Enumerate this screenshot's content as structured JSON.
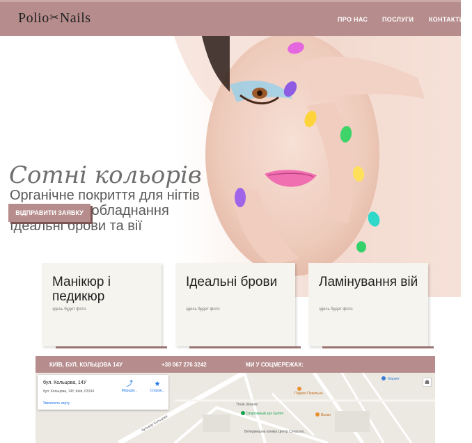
{
  "header": {
    "logo_left": "Polio",
    "logo_right": "Nails",
    "nav": [
      {
        "label": "ПРО НАС"
      },
      {
        "label": "ПОСЛУГИ"
      },
      {
        "label": "КОНТАКТИ"
      }
    ]
  },
  "hero": {
    "title": "Сотні кольорів",
    "lines": [
      "Органічне покриття для нігтів",
      "Професійне обладнання",
      "Ідеальні брови та вії"
    ],
    "cta": "ВІДПРАВИТИ ЗАЯВКУ"
  },
  "cards": [
    {
      "title": "Манікюр і педикюр",
      "note": "здесь будет фото"
    },
    {
      "title": "Ідеальні брови",
      "note": "здесь будет фото"
    },
    {
      "title": "Ламінування вій",
      "note": "здесь будет фото"
    }
  ],
  "footer": {
    "address": "КИЇВ, БУЛ. КОЛЬЦОВА 14У",
    "phone": "+38 067 276 3242",
    "social": "МИ У СОЦМЕРЕЖАХ:"
  },
  "map": {
    "place_title": "бул. Кольцова, 14У",
    "place_address": "бул. Кольцова, 14У, Київ, 03194",
    "enlarge_link": "Увеличить карту",
    "route_label": "Маршру...",
    "save_label": "Сохран...",
    "labels": [
      "Thule Ukraine",
      "Спортивный зал Gymm",
      "Піцерія Пекельна",
      "Busan",
      "Ветеринарна клініка Центр Сучасної...",
      "бульвар Кольцова",
      "Маркет"
    ]
  },
  "colors": {
    "brand": "#b68d8c",
    "card_bg": "#f6f4ee"
  }
}
